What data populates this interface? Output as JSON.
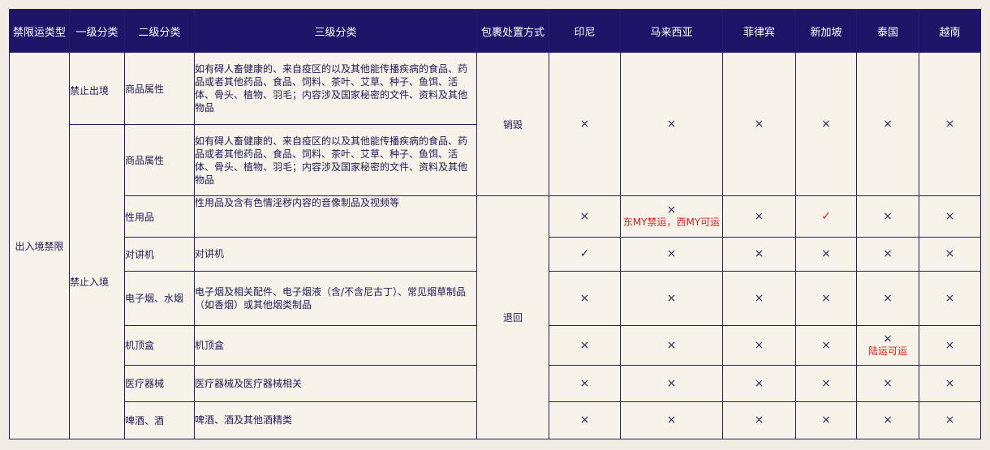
{
  "headers": {
    "type": "禁限运类型",
    "level1": "一级分类",
    "level2": "二级分类",
    "level3": "三级分类",
    "handling": "包裹处置方式",
    "idn": "印尼",
    "my": "马来西亚",
    "ph": "菲律宾",
    "sg": "新加坡",
    "th": "泰国",
    "vn": "越南"
  },
  "type_value": "出入境禁限",
  "level1": {
    "export": "禁止出境",
    "import": "禁止入境"
  },
  "handling": {
    "destroy": "销毁",
    "return": "退回"
  },
  "symbols": {
    "no": "×",
    "yes": "✓"
  },
  "notes": {
    "my_sex": "东MY禁运，西MY可运",
    "th_stb": "陆运可运"
  },
  "rows": [
    {
      "l2": "商品属性",
      "l3": "如有碍人畜健康的、来自疫区的以及其他能传播疾病的食品、药品或者其他药品、食品、饲料、茶叶、艾草、种子、鱼饵、活体、骨头、植物、羽毛；内容涉及国家秘密的文件、资料及其他物品"
    },
    {
      "l2": "商品属性",
      "l3": "如有碍人畜健康的、来自疫区的以及其他能传播疾病的食品、药品或者其他药品、食品、饲料、茶叶、艾草、种子、鱼饵、活体、骨头、植物、羽毛；内容涉及国家秘密的文件、资料及其他物品"
    },
    {
      "l2": "性用品",
      "l3": "性用品及含有色情淫秽内容的音像制品及视频等"
    },
    {
      "l2": "对讲机",
      "l3": "对讲机"
    },
    {
      "l2": "电子烟、水烟",
      "l3": "电子烟及相关配件、电子烟液（含/不含尼古丁）、常见烟草制品（如香烟）或其他烟类制品"
    },
    {
      "l2": "机顶盒",
      "l3": "机顶盒"
    },
    {
      "l2": "医疗器械",
      "l3": "医疗器械及医疗器械相关"
    },
    {
      "l2": "啤酒、酒",
      "l3": "啤酒、酒及其他酒精类"
    }
  ]
}
